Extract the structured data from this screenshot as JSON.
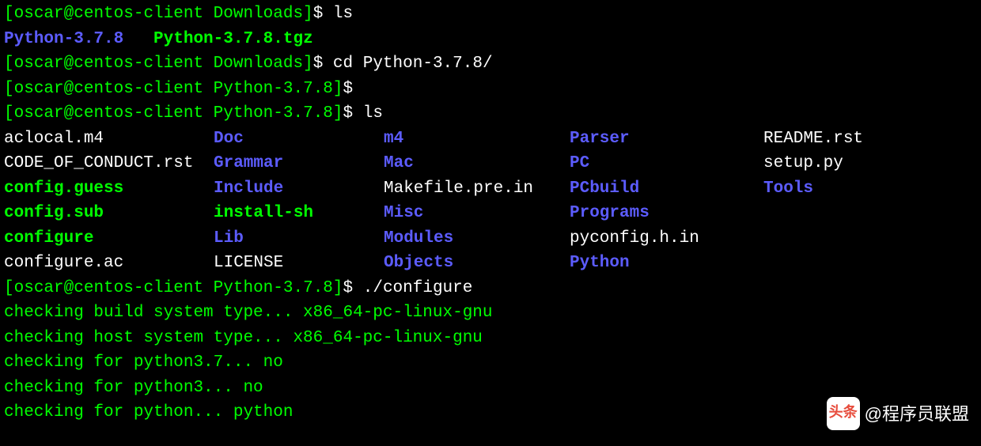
{
  "prompt": {
    "user": "oscar",
    "host": "centos-client",
    "dir_downloads": "Downloads",
    "dir_python": "Python-3.7.8",
    "bracket_open": "[",
    "bracket_close": "]",
    "at": "@",
    "dollar": "$ "
  },
  "commands": {
    "ls": "ls",
    "cd": "cd Python-3.7.8/",
    "configure": "./configure"
  },
  "ls_downloads": {
    "dir1": "Python-3.7.8",
    "file1": "Python-3.7.8.tgz"
  },
  "ls_python": {
    "r1": {
      "c1": "aclocal.m4",
      "c2": "Doc",
      "c3": "m4",
      "c4": "Parser",
      "c5": "README.rst"
    },
    "r2": {
      "c1": "CODE_OF_CONDUCT.rst",
      "c2": "Grammar",
      "c3": "Mac",
      "c4": "PC",
      "c5": "setup.py"
    },
    "r3": {
      "c1": "config.guess",
      "c2": "Include",
      "c3": "Makefile.pre.in",
      "c4": "PCbuild",
      "c5": "Tools"
    },
    "r4": {
      "c1": "config.sub",
      "c2": "install-sh",
      "c3": "Misc",
      "c4": "Programs"
    },
    "r5": {
      "c1": "configure",
      "c2": "Lib",
      "c3": "Modules",
      "c4": "pyconfig.h.in"
    },
    "r6": {
      "c1": "configure.ac",
      "c2": "LICENSE",
      "c3": "Objects",
      "c4": "Python"
    }
  },
  "configure_output": {
    "l1": "checking build system type... x86_64-pc-linux-gnu",
    "l2": "checking host system type... x86_64-pc-linux-gnu",
    "l3": "checking for python3.7... no",
    "l4": "checking for python3... no",
    "l5": "checking for python... python"
  },
  "watermark": {
    "icon": "头条",
    "text": "@程序员联盟"
  }
}
